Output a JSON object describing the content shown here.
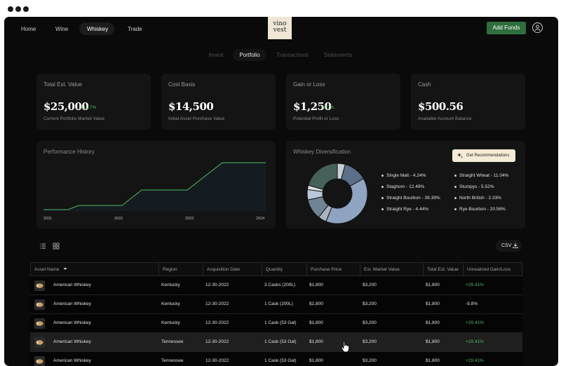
{
  "nav": {
    "items": [
      "Home",
      "Wine",
      "Whiskey",
      "Trade"
    ],
    "active": "Whiskey",
    "logo_line1": "vino",
    "logo_line2": "vest",
    "add_funds_label": "Add Funds"
  },
  "tabs": [
    {
      "label": "Invest",
      "active": false
    },
    {
      "label": "Portfolio",
      "active": true
    },
    {
      "label": "Transactions",
      "active": false
    },
    {
      "label": "Statements",
      "active": false
    }
  ],
  "cards": [
    {
      "title": "Total Est. Value",
      "value": "$25,000",
      "change": "+12.7%",
      "sub": "Current Portfolio Market Value"
    },
    {
      "title": "Cost Basis",
      "value": "$14,500",
      "change": "",
      "sub": "Initial Asset Purchase Value"
    },
    {
      "title": "Gain or Loss",
      "value": "$1,250",
      "change": "+2.7%",
      "sub": "Potential Profit or Loss"
    },
    {
      "title": "Cash",
      "value": "$500.56",
      "change": "",
      "sub": "Available Account Balance"
    }
  ],
  "performance": {
    "title": "Performance History",
    "years": [
      "2021",
      "2022",
      "2023",
      "2024"
    ],
    "line_color": "#4cba5f"
  },
  "diversification": {
    "title": "Whiskey Diversification",
    "recommend_label": "Get Recommendations",
    "legend": [
      "Single Malt - 4.24%",
      "Staghorn - 12.49%",
      "Straight Bourbon - 39.39%",
      "Straight Rye - 4.44%",
      "Straight Wheat - 11.04%",
      "Stumpys - 5.52%",
      "North British - 2.33%",
      "Rye Bourbon - 20.56%"
    ]
  },
  "chart_data": {
    "type": "pie",
    "title": "Whiskey Diversification",
    "categories": [
      "Single Malt",
      "Staghorn",
      "Straight Bourbon",
      "Straight Rye",
      "Straight Wheat",
      "Stumpys",
      "North British",
      "Rye Bourbon"
    ],
    "values": [
      4.24,
      12.49,
      39.39,
      4.44,
      11.04,
      5.52,
      2.33,
      20.56
    ],
    "colors": [
      "#c8d0d4",
      "#5b6f8a",
      "#8ea4c0",
      "#aab4be",
      "#6f8495",
      "#b7c8d8",
      "#d8dde0",
      "#46605a"
    ],
    "legend_position": "right"
  },
  "toolbar": {
    "csv_label": "CSV"
  },
  "table": {
    "columns": [
      "Asset Name",
      "Region",
      "Acquisition Date",
      "Quantity",
      "Purchase Price",
      "Est. Market Value",
      "Total Est. Value",
      "Unrealized Gain/Loss"
    ],
    "rows": [
      [
        "American Whiskey",
        "Kentucky",
        "12-30-2022",
        "3 Casks (200L)",
        "$1,800",
        "$3,200",
        "$1,800",
        "+29.41%"
      ],
      [
        "American Whiskey",
        "Kentucky",
        "12-30-2022",
        "1 Cask (200L)",
        "$1,800",
        "$3,200",
        "$1,800",
        "-9.8%"
      ],
      [
        "American Whiskey",
        "Kentucky",
        "12-30-2022",
        "1 Cask (53 Gal)",
        "$1,800",
        "$3,200",
        "$1,800",
        "+29.41%"
      ],
      [
        "American Whiskey",
        "Tennessee",
        "12-30-2022",
        "1 Cask (53 Gal)",
        "$1,800",
        "$3,200",
        "$1,800",
        "+29.41%"
      ],
      [
        "American Whiskey",
        "Tennessee",
        "12-30-2022",
        "1 Cask (53 Gal)",
        "$1,800",
        "$3,200",
        "$1,800",
        "+29.41%"
      ]
    ]
  }
}
